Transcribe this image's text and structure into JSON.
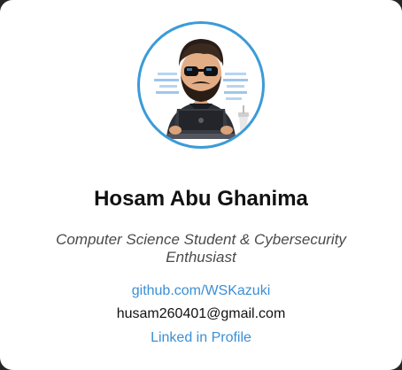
{
  "profile": {
    "name": "Hosam Abu Ghanima",
    "tagline": "Computer Science Student & Cybersecurity Enthusiast",
    "github": "github.com/WSKazuki",
    "email": "husam260401@gmail.com",
    "linkedin": "Linked in Profile"
  },
  "colors": {
    "accent": "#3b9bd8",
    "link": "#3b8fd6",
    "text": "#111111",
    "tagline": "#4a4a4a",
    "card": "#ffffff",
    "background": "#262626"
  },
  "icons": {
    "avatar": "hacker-avatar-illustration"
  }
}
